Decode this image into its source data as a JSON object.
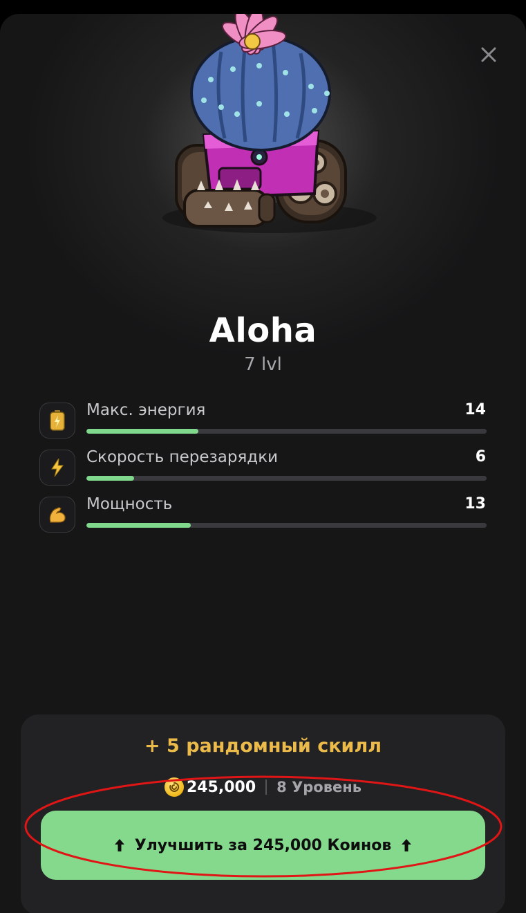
{
  "window": {
    "close_icon": "close-icon"
  },
  "robot": {
    "name": "Aloha",
    "level": "7 lvl",
    "image": "cactus-tank-robot"
  },
  "stats": [
    {
      "icon": "battery-icon",
      "label": "Макс. энергия",
      "value": "14",
      "progress": 0.28
    },
    {
      "icon": "lightning-icon",
      "label": "Скорость перезарядки",
      "value": "6",
      "progress": 0.12
    },
    {
      "icon": "flexed-biceps-icon",
      "label": "Мощность",
      "value": "13",
      "progress": 0.26
    }
  ],
  "upgrade": {
    "reward_text": "+ 5 рандомный скилл",
    "price": "245,000",
    "next_level": "8 Уровень",
    "button_label": "Улучшить за 245,000 Коинов",
    "button_color": "#85d98c",
    "reward_color": "#ecba4a"
  },
  "colors": {
    "background": "#161617",
    "progress_fill": "#7fd88b",
    "annotation": "#e01515"
  }
}
